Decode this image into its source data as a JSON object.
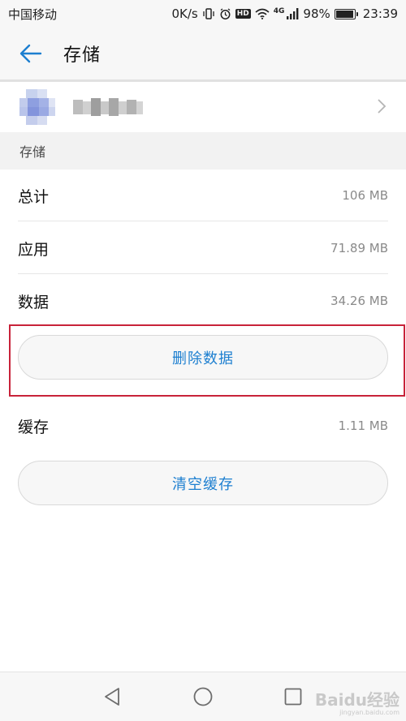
{
  "status_bar": {
    "carrier": "中国移动",
    "net_speed": "0K/s",
    "hd_label": "HD",
    "network_type": "4G",
    "battery_percent": "98%",
    "battery_level": 0.98,
    "time": "23:39"
  },
  "app_bar": {
    "title": "存储",
    "back_icon": "arrow-left-icon"
  },
  "section": {
    "header": "存储"
  },
  "rows": {
    "total": {
      "label": "总计",
      "value": "106 MB"
    },
    "apps": {
      "label": "应用",
      "value": "71.89 MB"
    },
    "data": {
      "label": "数据",
      "value": "34.26 MB"
    },
    "cache": {
      "label": "缓存",
      "value": "1.11 MB"
    }
  },
  "buttons": {
    "delete_data": "删除数据",
    "clear_cache": "清空缓存"
  },
  "nav_bar": {
    "back_icon": "triangle-back-icon",
    "home_icon": "circle-home-icon",
    "recents_icon": "square-recents-icon"
  },
  "watermark": {
    "text": "Baidu经验",
    "sub": "jingyan.baidu.com"
  },
  "colors": {
    "accent": "#1d7fd0",
    "highlight": "#c8233a",
    "background": "#f7f7f7"
  }
}
